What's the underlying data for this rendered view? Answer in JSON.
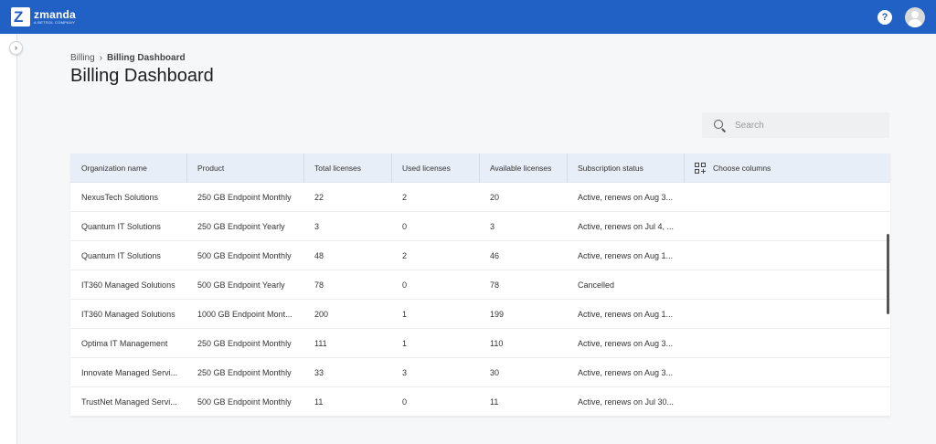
{
  "brand": {
    "name": "zmanda",
    "tagline": "A BETSOL COMPANY",
    "logo_letter": "Z"
  },
  "header": {
    "help_label": "?"
  },
  "sidebar": {
    "toggle_icon": "›"
  },
  "breadcrumb": {
    "parent": "Billing",
    "separator": "›",
    "current": "Billing Dashboard"
  },
  "page": {
    "title": "Billing Dashboard"
  },
  "search": {
    "placeholder": "Search",
    "value": ""
  },
  "table": {
    "columns": [
      "Organization name",
      "Product",
      "Total licenses",
      "Used licenses",
      "Available licenses",
      "Subscription status"
    ],
    "choose_columns_label": "Choose columns",
    "rows": [
      {
        "org": "NexusTech Solutions",
        "product": "250 GB Endpoint Monthly",
        "total": "22",
        "used": "2",
        "available": "20",
        "status": "Active, renews on Aug 3..."
      },
      {
        "org": "Quantum IT Solutions",
        "product": "250 GB Endpoint Yearly",
        "total": "3",
        "used": "0",
        "available": "3",
        "status": "Active, renews on Jul 4, ..."
      },
      {
        "org": "Quantum IT Solutions",
        "product": "500 GB Endpoint Monthly",
        "total": "48",
        "used": "2",
        "available": "46",
        "status": "Active, renews on Aug 1..."
      },
      {
        "org": "IT360 Managed Solutions",
        "product": "500 GB Endpoint Yearly",
        "total": "78",
        "used": "0",
        "available": "78",
        "status": "Cancelled"
      },
      {
        "org": "IT360 Managed Solutions",
        "product": "1000 GB Endpoint Mont...",
        "total": "200",
        "used": "1",
        "available": "199",
        "status": "Active, renews on Aug 1..."
      },
      {
        "org": "Optima IT Management",
        "product": "250 GB Endpoint Monthly",
        "total": "111",
        "used": "1",
        "available": "110",
        "status": "Active, renews on Aug 3..."
      },
      {
        "org": "Innovate Managed Servi...",
        "product": "250 GB Endpoint Monthly",
        "total": "33",
        "used": "3",
        "available": "30",
        "status": "Active, renews on Aug 3..."
      },
      {
        "org": "TrustNet Managed Servi...",
        "product": "500 GB Endpoint Monthly",
        "total": "11",
        "used": "0",
        "available": "11",
        "status": "Active, renews on Jul 30..."
      }
    ]
  },
  "colors": {
    "topbar": "#2160c4",
    "table_header": "#e8eef8",
    "page_bg": "#f6f7f9"
  },
  "icons": {
    "search": "search-icon",
    "help": "help-icon",
    "avatar": "user-avatar-icon",
    "columns": "choose-columns-icon",
    "toggle": "chevron-right-icon"
  }
}
